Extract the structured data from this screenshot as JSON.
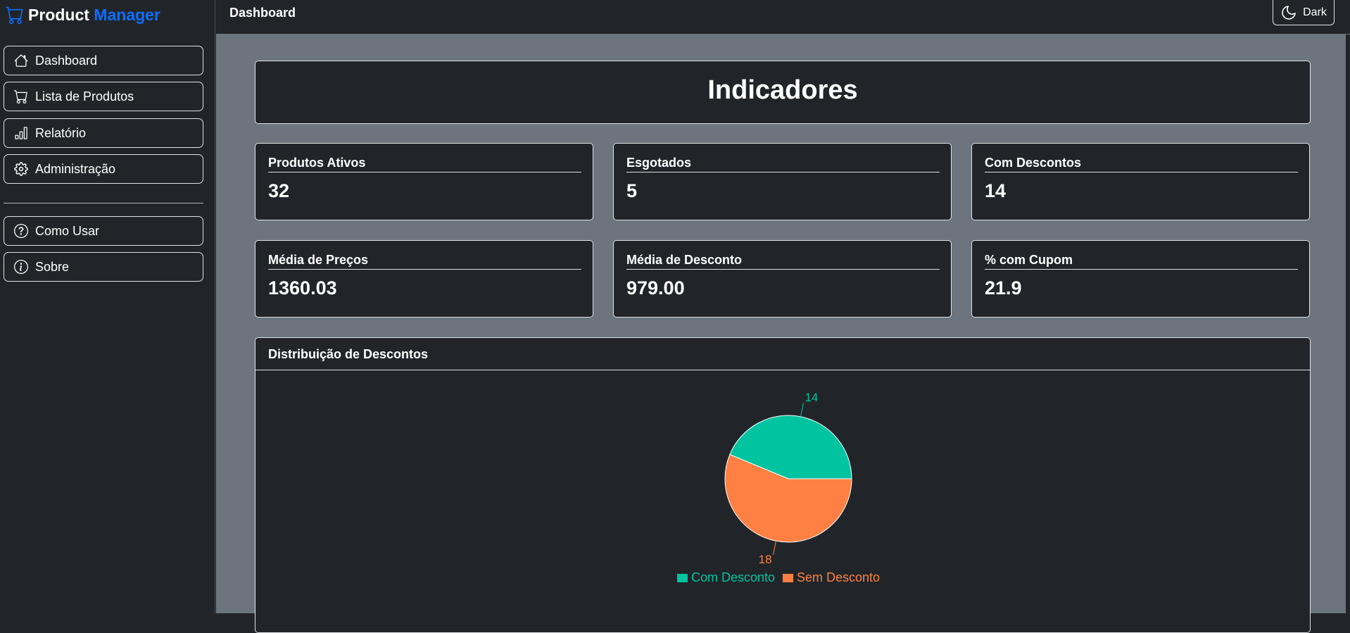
{
  "brand": {
    "part1": "Product",
    "part2": "Manager",
    "accent_color": "#0d6efd"
  },
  "sidebar": {
    "items": [
      {
        "label": "Dashboard",
        "icon": "home-icon"
      },
      {
        "label": "Lista de Produtos",
        "icon": "cart-icon"
      },
      {
        "label": "Relatório",
        "icon": "bar-chart-icon"
      },
      {
        "label": "Administração",
        "icon": "gear-icon"
      }
    ],
    "help_items": [
      {
        "label": "Como Usar",
        "icon": "question-circle-icon"
      },
      {
        "label": "Sobre",
        "icon": "info-circle-icon"
      }
    ]
  },
  "header": {
    "title": "Dashboard",
    "theme_label": "Dark",
    "theme_icon": "moon-icon"
  },
  "main": {
    "heading": "Indicadores",
    "kpis": [
      {
        "label": "Produtos Ativos",
        "value": "32"
      },
      {
        "label": "Esgotados",
        "value": "5"
      },
      {
        "label": "Com Descontos",
        "value": "14"
      },
      {
        "label": "Média de Preços",
        "value": "1360.03"
      },
      {
        "label": "Média de Desconto",
        "value": "979.00"
      },
      {
        "label": "% com Cupom",
        "value": "21.9"
      }
    ],
    "chart_title": "Distribuição de Descontos"
  },
  "chart_data": {
    "type": "pie",
    "title": "Distribuição de Descontos",
    "categories": [
      "Com Desconto",
      "Sem Desconto"
    ],
    "values": [
      14,
      18
    ],
    "colors": [
      "#00c49f",
      "#ff8042"
    ],
    "legend": "bottom"
  }
}
